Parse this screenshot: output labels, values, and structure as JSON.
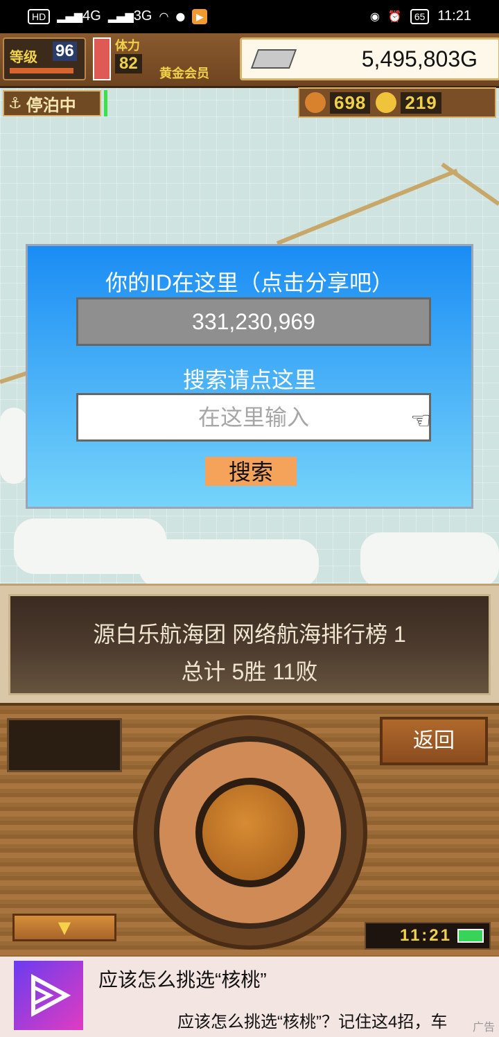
{
  "status_bar": {
    "net1": "4G",
    "net2": "3G",
    "battery": "65",
    "time": "11:21"
  },
  "hud": {
    "level_label": "等级",
    "level_value": "96",
    "stamina_label": "体力",
    "stamina_value": "82",
    "member_label": "黄金会员",
    "gold_amount": "5,495,803G",
    "anchor_status": "停泊中",
    "resource1": "698",
    "resource2": "219"
  },
  "dialog": {
    "title": "你的ID在这里（点击分享吧）",
    "player_id": "331,230,969",
    "search_hint": "搜索请点这里",
    "search_placeholder": "在这里输入",
    "search_button": "搜索"
  },
  "ranking": {
    "line1": "源白乐航海团  网络航海排行榜  1",
    "line2": "总计 5胜 11败"
  },
  "console": {
    "back_button": "返回",
    "down_arrow": "▼",
    "clock": "11:21"
  },
  "ad": {
    "title": "应该怎么挑选“核桃”",
    "subtitle": "应该怎么挑选“核桃”？记住这4招，车",
    "tag": "广告"
  },
  "colors": {
    "dialog_top": "#1a8cf4",
    "dialog_bottom": "#76d4fa",
    "search_button_bg": "#f5a35b",
    "gold_text": "#f0d24a"
  }
}
